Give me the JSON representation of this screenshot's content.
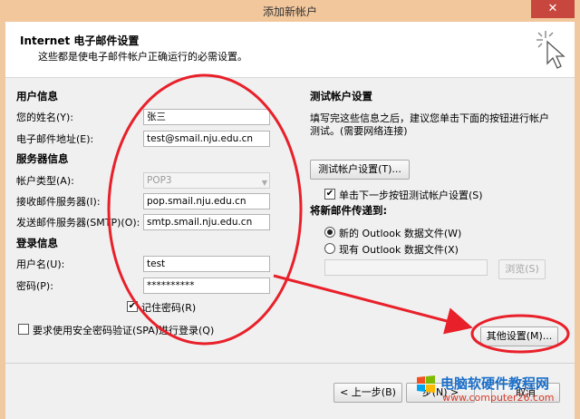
{
  "window": {
    "title": "添加新帐户",
    "close_glyph": "✕"
  },
  "header": {
    "title": "Internet 电子邮件设置",
    "subtitle": "这些都是使电子邮件帐户正确运行的必需设置。"
  },
  "user_info": {
    "section": "用户信息",
    "name_label": "您的姓名(Y):",
    "name_value": "张三",
    "email_label": "电子邮件地址(E):",
    "email_value": "test@smail.nju.edu.cn"
  },
  "server_info": {
    "section": "服务器信息",
    "type_label": "帐户类型(A):",
    "type_value": "POP3",
    "incoming_label": "接收邮件服务器(I):",
    "incoming_value": "pop.smail.nju.edu.cn",
    "outgoing_label": "发送邮件服务器(SMTP)(O):",
    "outgoing_value": "smtp.smail.nju.edu.cn"
  },
  "login_info": {
    "section": "登录信息",
    "username_label": "用户名(U):",
    "username_value": "test",
    "password_label": "密码(P):",
    "password_value": "**********",
    "remember_label": "记住密码(R)",
    "spa_label": "要求使用安全密码验证(SPA)进行登录(Q)"
  },
  "test_settings": {
    "section": "测试帐户设置",
    "description_1": "填写完这些信息之后，建议您单击下面的按钮进行帐户",
    "description_2": "测试。(需要网络连接)",
    "test_button": "测试帐户设置(T)...",
    "auto_test_label": "单击下一步按钮测试帐户设置(S)"
  },
  "deliver": {
    "section": "将新邮件传递到:",
    "new_file_label": "新的 Outlook 数据文件(W)",
    "existing_file_label": "现有 Outlook 数据文件(X)",
    "browse_button": "浏览(S)"
  },
  "buttons": {
    "more_settings": "其他设置(M)...",
    "back": "< 上一步(B)",
    "next": "步(N) >",
    "cancel": "取消"
  },
  "watermark": {
    "title": "电脑软硬件教程网",
    "url": "www.computer26.com"
  },
  "colors": {
    "annotation": "#e8202a",
    "title_bar": "#f2c79c"
  }
}
